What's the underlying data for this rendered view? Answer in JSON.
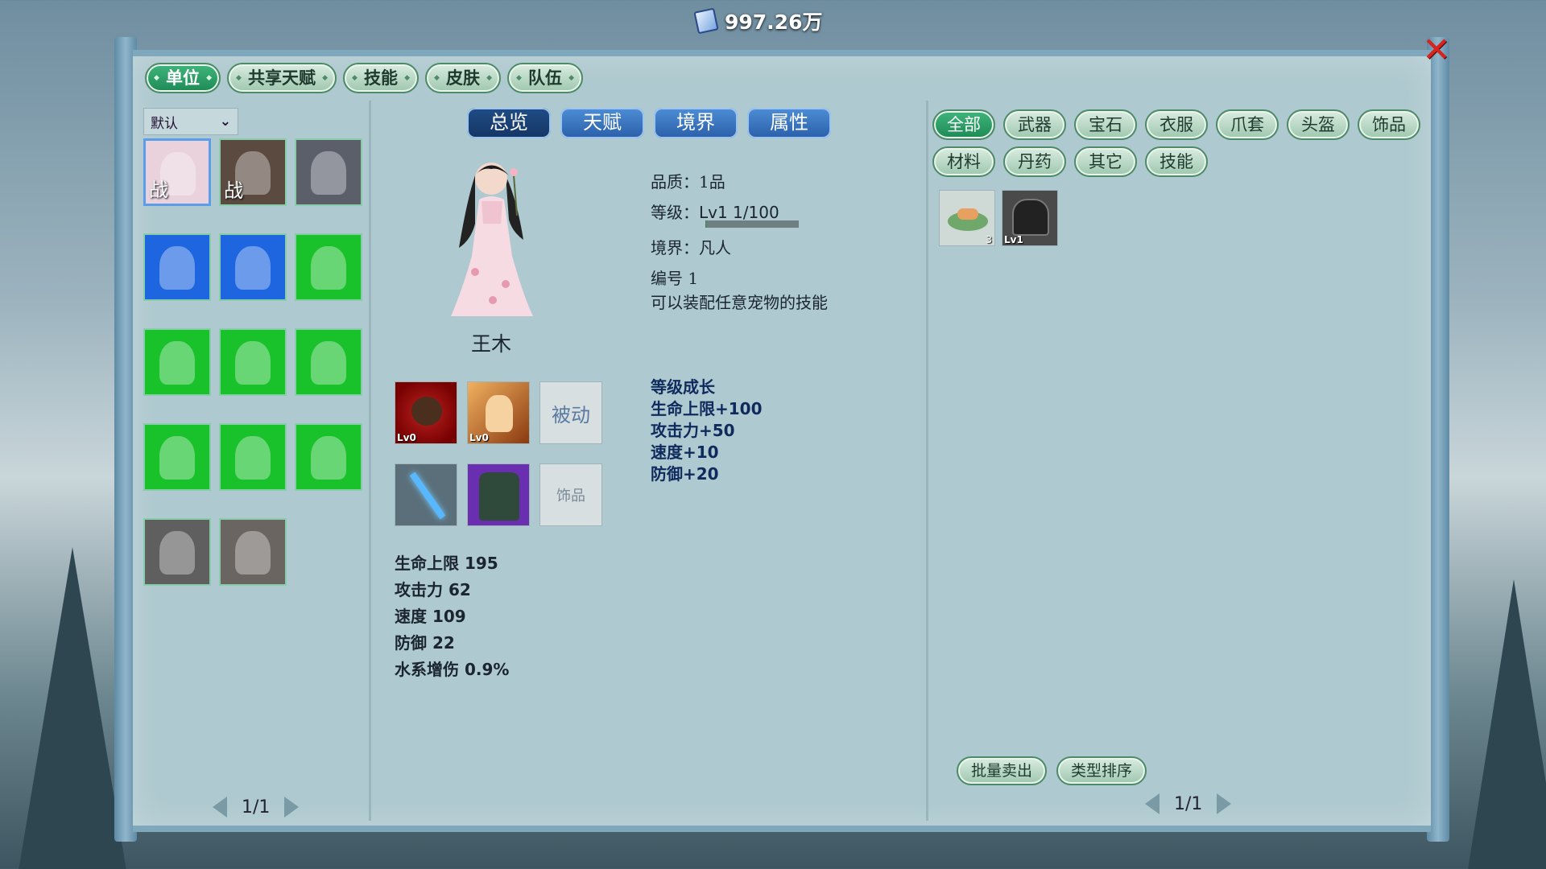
{
  "currency": {
    "amount": "997.26万",
    "icon": "gem-icon"
  },
  "top_tabs": [
    {
      "label": "单位",
      "active": true
    },
    {
      "label": "共享天赋",
      "active": false
    },
    {
      "label": "技能",
      "active": false
    },
    {
      "label": "皮肤",
      "active": false
    },
    {
      "label": "队伍",
      "active": false
    }
  ],
  "unit_list": {
    "sort_value": "默认",
    "units": [
      {
        "name": "wang-mu",
        "tag": "战",
        "selected": true,
        "bg": "#e9d2dc"
      },
      {
        "name": "boar",
        "tag": "战",
        "selected": false,
        "bg": "#5a4a40"
      },
      {
        "name": "purple-dragon",
        "tag": "",
        "selected": false,
        "bg": "#5a5f6a"
      },
      {
        "name": "ghost",
        "tag": "",
        "selected": false,
        "bg": "#1e66e0"
      },
      {
        "name": "sea-serpent",
        "tag": "",
        "selected": false,
        "bg": "#1e66e0"
      },
      {
        "name": "man-eater-flower",
        "tag": "",
        "selected": false,
        "bg": "#19c12b"
      },
      {
        "name": "vine",
        "tag": "",
        "selected": false,
        "bg": "#19c12b"
      },
      {
        "name": "white-deer",
        "tag": "",
        "selected": false,
        "bg": "#19c12b"
      },
      {
        "name": "boar-2",
        "tag": "",
        "selected": false,
        "bg": "#19c12b"
      },
      {
        "name": "spider",
        "tag": "",
        "selected": false,
        "bg": "#19c12b"
      },
      {
        "name": "zombie",
        "tag": "",
        "selected": false,
        "bg": "#19c12b"
      },
      {
        "name": "white-deer-2",
        "tag": "",
        "selected": false,
        "bg": "#19c12b"
      },
      {
        "name": "fox-girl",
        "tag": "",
        "selected": false,
        "bg": "#5f5f5f"
      },
      {
        "name": "blue-fox",
        "tag": "",
        "selected": false,
        "bg": "#6a6560"
      }
    ],
    "page": "1/1"
  },
  "detail": {
    "sub_tabs": [
      {
        "label": "总览",
        "active": true
      },
      {
        "label": "天赋",
        "active": false
      },
      {
        "label": "境界",
        "active": false
      },
      {
        "label": "属性",
        "active": false
      }
    ],
    "name": "王木",
    "quality": "品质：1品",
    "level_label": "等级：",
    "level_value": "Lv1 1/100",
    "xp_progress": 0.01,
    "realm": "境界：凡人",
    "number": "编号 1",
    "description": "可以装配任意宠物的技能",
    "growth": {
      "title": "等级成长",
      "lines": [
        "生命上限+100",
        "攻击力+50",
        "速度+10",
        "防御+20"
      ]
    },
    "skill_slots": [
      {
        "lv": "Lv0",
        "icon": "boar-skill-icon",
        "empty": false
      },
      {
        "lv": "Lv0",
        "icon": "palm-skill-icon",
        "empty": false
      },
      {
        "label": "被动",
        "empty": true
      }
    ],
    "equip_slots": [
      {
        "icon": "staff-icon",
        "empty": false
      },
      {
        "icon": "armor-icon",
        "empty": false
      },
      {
        "label": "饰品",
        "empty": true
      }
    ],
    "stats": [
      "生命上限 195",
      "攻击力 62",
      "速度 109",
      "防御 22",
      "水系增伤 0.9%"
    ]
  },
  "inventory": {
    "filters": [
      {
        "label": "全部",
        "active": true
      },
      {
        "label": "武器",
        "active": false
      },
      {
        "label": "宝石",
        "active": false
      },
      {
        "label": "衣服",
        "active": false
      },
      {
        "label": "爪套",
        "active": false
      },
      {
        "label": "头盔",
        "active": false
      },
      {
        "label": "饰品",
        "active": false
      },
      {
        "label": "材料",
        "active": false
      },
      {
        "label": "丹药",
        "active": false
      },
      {
        "label": "其它",
        "active": false
      },
      {
        "label": "技能",
        "active": false
      }
    ],
    "items": [
      {
        "icon": "pill-dish-icon",
        "count": "3"
      },
      {
        "icon": "helmet-icon",
        "lv": "Lv1"
      }
    ],
    "bulk_sell": "批量卖出",
    "sort_type": "类型排序",
    "page": "1/1"
  }
}
